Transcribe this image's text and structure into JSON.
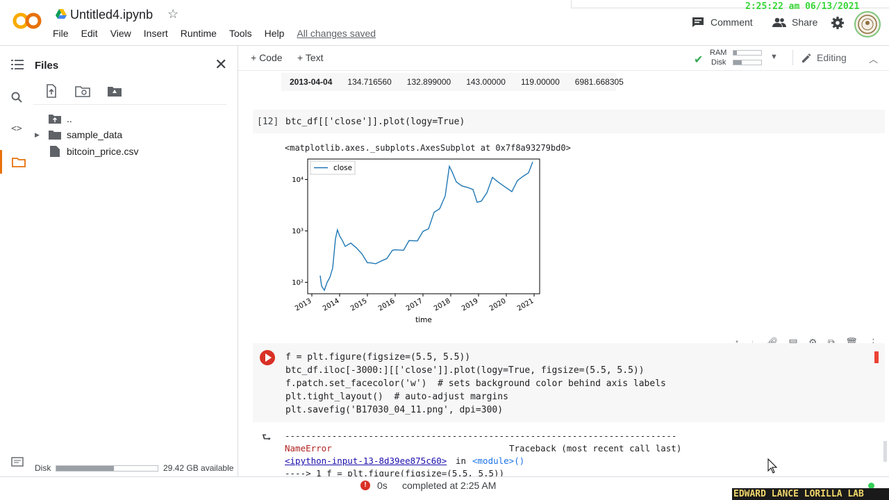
{
  "header": {
    "notebook_title": "Untitled4.ipynb",
    "menu": [
      "File",
      "Edit",
      "View",
      "Insert",
      "Runtime",
      "Tools",
      "Help"
    ],
    "save_status": "All changes saved",
    "timestamp": "2:25:22 am 06/13/2021",
    "comment_label": "Comment",
    "share_label": "Share",
    "logo_text": "CO"
  },
  "toolbar": {
    "add_code": "+ Code",
    "add_text": "+ Text",
    "ram_label": "RAM",
    "disk_label": "Disk",
    "ram_usage": 0.12,
    "disk_usage": 0.3,
    "editing_label": "Editing"
  },
  "sidebar": {
    "title": "Files",
    "tree": [
      {
        "name": "..",
        "type": "parent"
      },
      {
        "name": "sample_data",
        "type": "folder"
      },
      {
        "name": "bitcoin_price.csv",
        "type": "file"
      }
    ],
    "disk_label": "Disk",
    "disk_usage": 0.57,
    "disk_available": "29.42 GB available"
  },
  "cells": {
    "prev_output_row": {
      "index": "2013-04-04",
      "values": [
        "134.716560",
        "132.899000",
        "143.00000",
        "119.00000",
        "6981.668305"
      ]
    },
    "cell12": {
      "exec_count": "[12]",
      "code": "btc_df[['close']].plot(logy=True)",
      "output_repr": "<matplotlib.axes._subplots.AxesSubplot at 0x7f8a93279bd0>"
    },
    "cell13": {
      "lines": [
        "f = plt.figure(figsize=(5.5, 5.5))",
        "btc_df.iloc[-3000:][['close']].plot(logy=True, figsize=(5.5, 5.5))",
        "f.patch.set_facecolor('w')  # sets background color behind axis labels",
        "plt.tight_layout()  # auto-adjust margins",
        "plt.savefig('B17030_04_11.png', dpi=300)"
      ],
      "output": {
        "dashes": "---------------------------------------------------------------------------",
        "error_name": "NameError",
        "traceback_label": "Traceback (most recent call last)",
        "input_link": "<ipython-input-13-8d39ee875c60>",
        "in_text": "in",
        "module_text": "<module>()",
        "arrow_line": "----> 1 f = plt.figure(figsize=(5.5, 5.5))"
      }
    }
  },
  "chart_data": {
    "type": "line",
    "title": "",
    "xlabel": "time",
    "ylabel": "",
    "log_y": true,
    "ylim": [
      60,
      25000
    ],
    "y_ticks": [
      "10²",
      "10³",
      "10⁴"
    ],
    "x_ticks": [
      "2013",
      "2014",
      "2015",
      "2016",
      "2017",
      "2018",
      "2019",
      "2020",
      "2021"
    ],
    "legend": "close",
    "legend_position": "top-left",
    "color": "#1f77b4",
    "series": [
      {
        "name": "close",
        "x": [
          2013.3,
          2013.35,
          2013.45,
          2013.55,
          2013.65,
          2013.75,
          2013.85,
          2013.92,
          2014.0,
          2014.1,
          2014.2,
          2014.4,
          2014.6,
          2014.8,
          2015.0,
          2015.1,
          2015.3,
          2015.5,
          2015.7,
          2015.9,
          2016.0,
          2016.3,
          2016.5,
          2016.8,
          2017.0,
          2017.2,
          2017.4,
          2017.6,
          2017.8,
          2017.95,
          2018.05,
          2018.2,
          2018.4,
          2018.6,
          2018.8,
          2018.95,
          2019.1,
          2019.3,
          2019.5,
          2019.7,
          2019.9,
          2020.2,
          2020.4,
          2020.6,
          2020.8,
          2020.95
        ],
        "y": [
          135,
          85,
          70,
          100,
          125,
          190,
          700,
          1050,
          800,
          650,
          500,
          580,
          470,
          360,
          240,
          240,
          230,
          260,
          290,
          420,
          430,
          420,
          650,
          640,
          980,
          1100,
          2300,
          2700,
          4800,
          18000,
          14000,
          9000,
          7500,
          7000,
          6400,
          3600,
          3800,
          5500,
          11000,
          9000,
          7500,
          5800,
          9500,
          11500,
          13500,
          22000
        ]
      }
    ]
  },
  "status": {
    "error_count": "!",
    "duration": "0s",
    "message": "completed at 2:25 AM"
  },
  "watermark": "EDWARD LANCE LORILLA LAB"
}
